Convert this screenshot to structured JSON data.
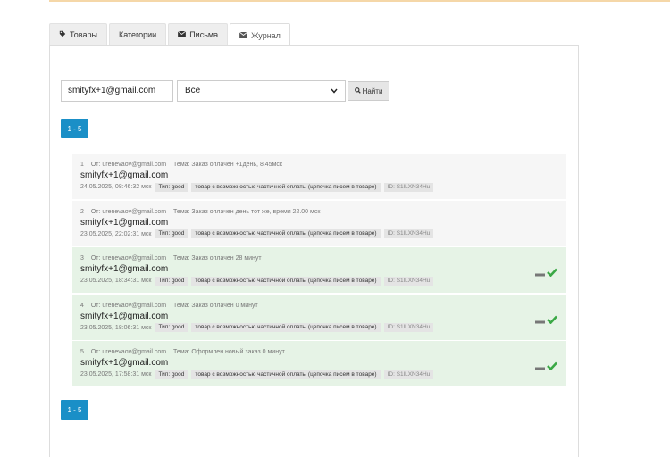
{
  "tabs": [
    {
      "label": "Товары",
      "icon": "tag-icon"
    },
    {
      "label": "Категории",
      "icon": ""
    },
    {
      "label": "Письма",
      "icon": "envelope-icon"
    },
    {
      "label": "Журнал",
      "icon": "envelope-icon",
      "active": true
    }
  ],
  "search": {
    "value": "smityfx+1@gmail.com",
    "filter_value": "Все",
    "button_label": "Найти",
    "button_icon": "search-icon"
  },
  "pagination": {
    "label": "1 - 5"
  },
  "log_items": [
    {
      "num": "1",
      "from": "От: urenevaov@gmail.com",
      "subject": "Тема: Заказ оплачен +1день, 8.45мск",
      "email": "smityfx+1@gmail.com",
      "date": "24.05.2025, 08:46:32 мск",
      "type": "Тип: good",
      "product": "товар с возможностью частичной оплаты (цепочка писем в товаре)",
      "id": "ID: S1lLXN34Hu",
      "paid": false
    },
    {
      "num": "2",
      "from": "От: urenevaov@gmail.com",
      "subject": "Тема: Заказ оплачен день тот же, время 22.00 мск",
      "email": "smityfx+1@gmail.com",
      "date": "23.05.2025, 22:02:31 мск",
      "type": "Тип: good",
      "product": "товар с возможностью частичной оплаты (цепочка писем в товаре)",
      "id": "ID: S1lLXN34Hu",
      "paid": false
    },
    {
      "num": "3",
      "from": "От: urenevaov@gmail.com",
      "subject": "Тема: Заказ оплачен 28 минут",
      "email": "smityfx+1@gmail.com",
      "date": "23.05.2025, 18:34:31 мск",
      "type": "Тип: good",
      "product": "товар с возможностью частичной оплаты (цепочка писем в товаре)",
      "id": "ID: S1lLXN34Hu",
      "paid": true
    },
    {
      "num": "4",
      "from": "От: urenevaov@gmail.com",
      "subject": "Тема: Заказ оплачен 0 минут",
      "email": "smityfx+1@gmail.com",
      "date": "23.05.2025, 18:06:31 мск",
      "type": "Тип: good",
      "product": "товар с возможностью частичной оплаты (цепочка писем в товаре)",
      "id": "ID: S1lLXN34Hu",
      "paid": true
    },
    {
      "num": "5",
      "from": "От: urenevaov@gmail.com",
      "subject": "Тема: Оформлен новый заказ 0 минут",
      "email": "smityfx+1@gmail.com",
      "date": "23.05.2025, 17:58:31 мск",
      "type": "Тип: good",
      "product": "товар с возможностью частичной оплаты (цепочка писем в товаре)",
      "id": "ID: S1lLXN34Hu",
      "paid": true
    }
  ],
  "colors": {
    "accent": "#1a8fc7",
    "paid_bg": "#e6f3e6",
    "check": "#3aa845",
    "dash": "#777777"
  }
}
